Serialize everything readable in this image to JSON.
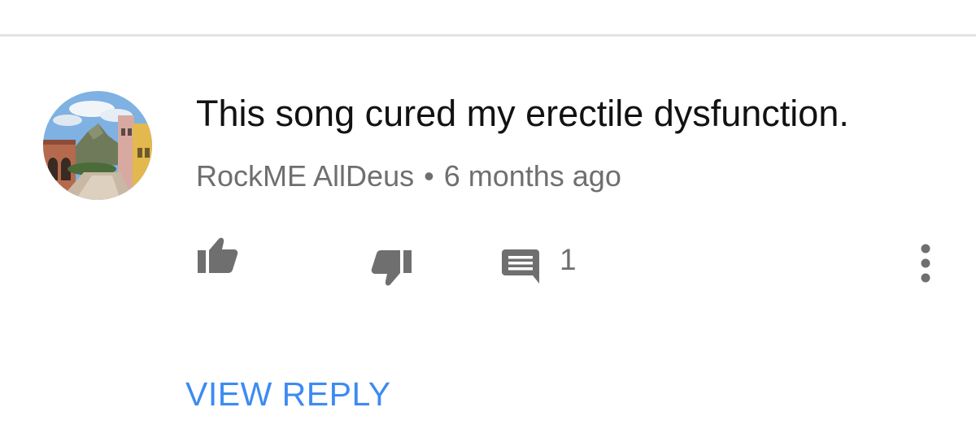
{
  "comment": {
    "text": "This song cured my erectile dysfunction.",
    "author": "RockME AllDeus",
    "separator": "•",
    "timestamp": "6 months ago"
  },
  "actions": {
    "like_icon": "thumbs-up-icon",
    "dislike_icon": "thumbs-down-icon",
    "reply_icon": "comment-icon",
    "reply_count": "1",
    "more_icon": "vertical-dots-icon"
  },
  "replies": {
    "view_label": "VIEW REPLY"
  },
  "colors": {
    "text_primary": "#121212",
    "text_secondary": "#6f6f6f",
    "link_blue": "#3d8bf2",
    "divider": "#e3e3e3"
  }
}
